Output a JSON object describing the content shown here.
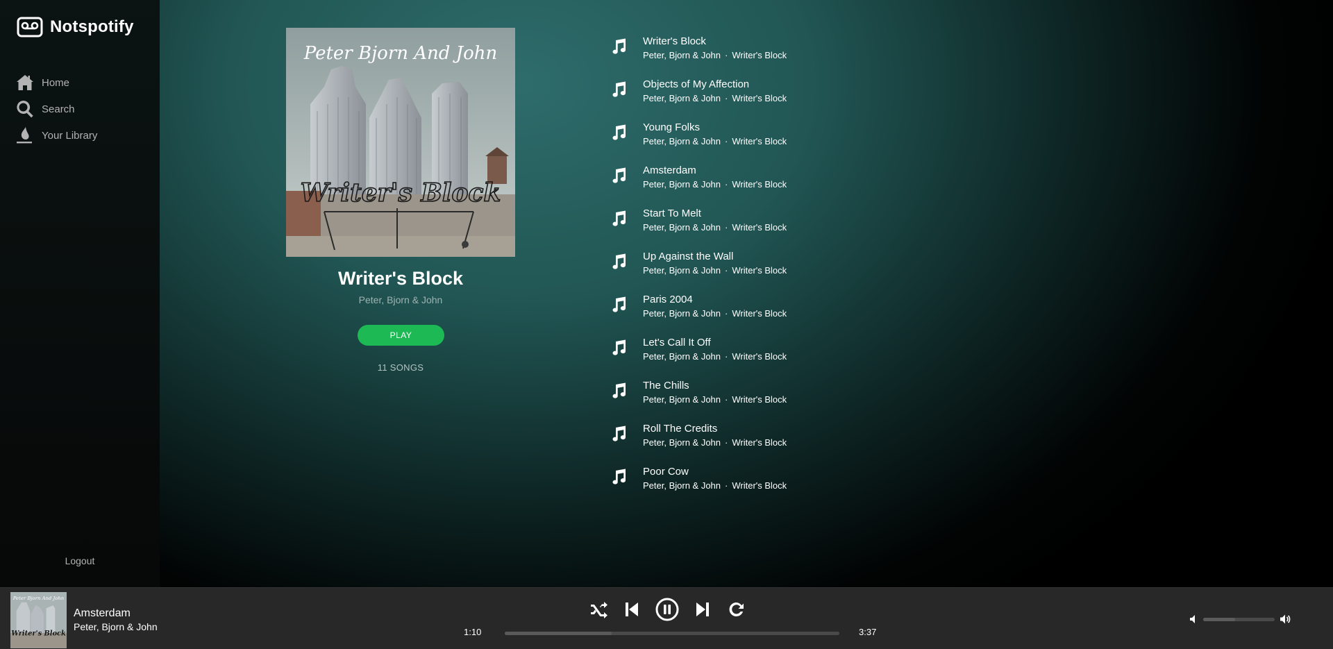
{
  "app": {
    "name": "Notspotify"
  },
  "sidebar": {
    "items": [
      {
        "label": "Home",
        "icon": "home-icon"
      },
      {
        "label": "Search",
        "icon": "search-icon"
      },
      {
        "label": "Your Library",
        "icon": "library-icon"
      }
    ],
    "logout": "Logout"
  },
  "album": {
    "cover_band_text": "Peter Bjorn And John",
    "cover_sign_text": "Writer's Block",
    "title": "Writer's Block",
    "artist": "Peter, Bjorn & John",
    "play_label": "PLAY",
    "song_count": "11 SONGS"
  },
  "tracks": [
    {
      "name": "Writer's Block",
      "artist": "Peter, Bjorn & John",
      "album": "Writer's Block"
    },
    {
      "name": "Objects of My Affection",
      "artist": "Peter, Bjorn & John",
      "album": "Writer's Block"
    },
    {
      "name": "Young Folks",
      "artist": "Peter, Bjorn & John",
      "album": "Writer's Block"
    },
    {
      "name": "Amsterdam",
      "artist": "Peter, Bjorn & John",
      "album": "Writer's Block"
    },
    {
      "name": "Start To Melt",
      "artist": "Peter, Bjorn & John",
      "album": "Writer's Block"
    },
    {
      "name": "Up Against the Wall",
      "artist": "Peter, Bjorn & John",
      "album": "Writer's Block"
    },
    {
      "name": "Paris 2004",
      "artist": "Peter, Bjorn & John",
      "album": "Writer's Block"
    },
    {
      "name": "Let's Call It Off",
      "artist": "Peter, Bjorn & John",
      "album": "Writer's Block"
    },
    {
      "name": "The Chills",
      "artist": "Peter, Bjorn & John",
      "album": "Writer's Block"
    },
    {
      "name": "Roll The Credits",
      "artist": "Peter, Bjorn & John",
      "album": "Writer's Block"
    },
    {
      "name": "Poor Cow",
      "artist": "Peter, Bjorn & John",
      "album": "Writer's Block"
    }
  ],
  "player": {
    "now_playing": {
      "title": "Amsterdam",
      "artist": "Peter, Bjorn & John"
    },
    "current_time": "1:10",
    "total_time": "3:37",
    "progress": 0.32,
    "volume": 0.45,
    "controls": [
      "shuffle-icon",
      "previous-icon",
      "pause-icon",
      "next-icon",
      "repeat-icon"
    ]
  },
  "colors": {
    "accent": "#1db954",
    "player_bg": "#282828",
    "teal": "#2e6c6b"
  }
}
